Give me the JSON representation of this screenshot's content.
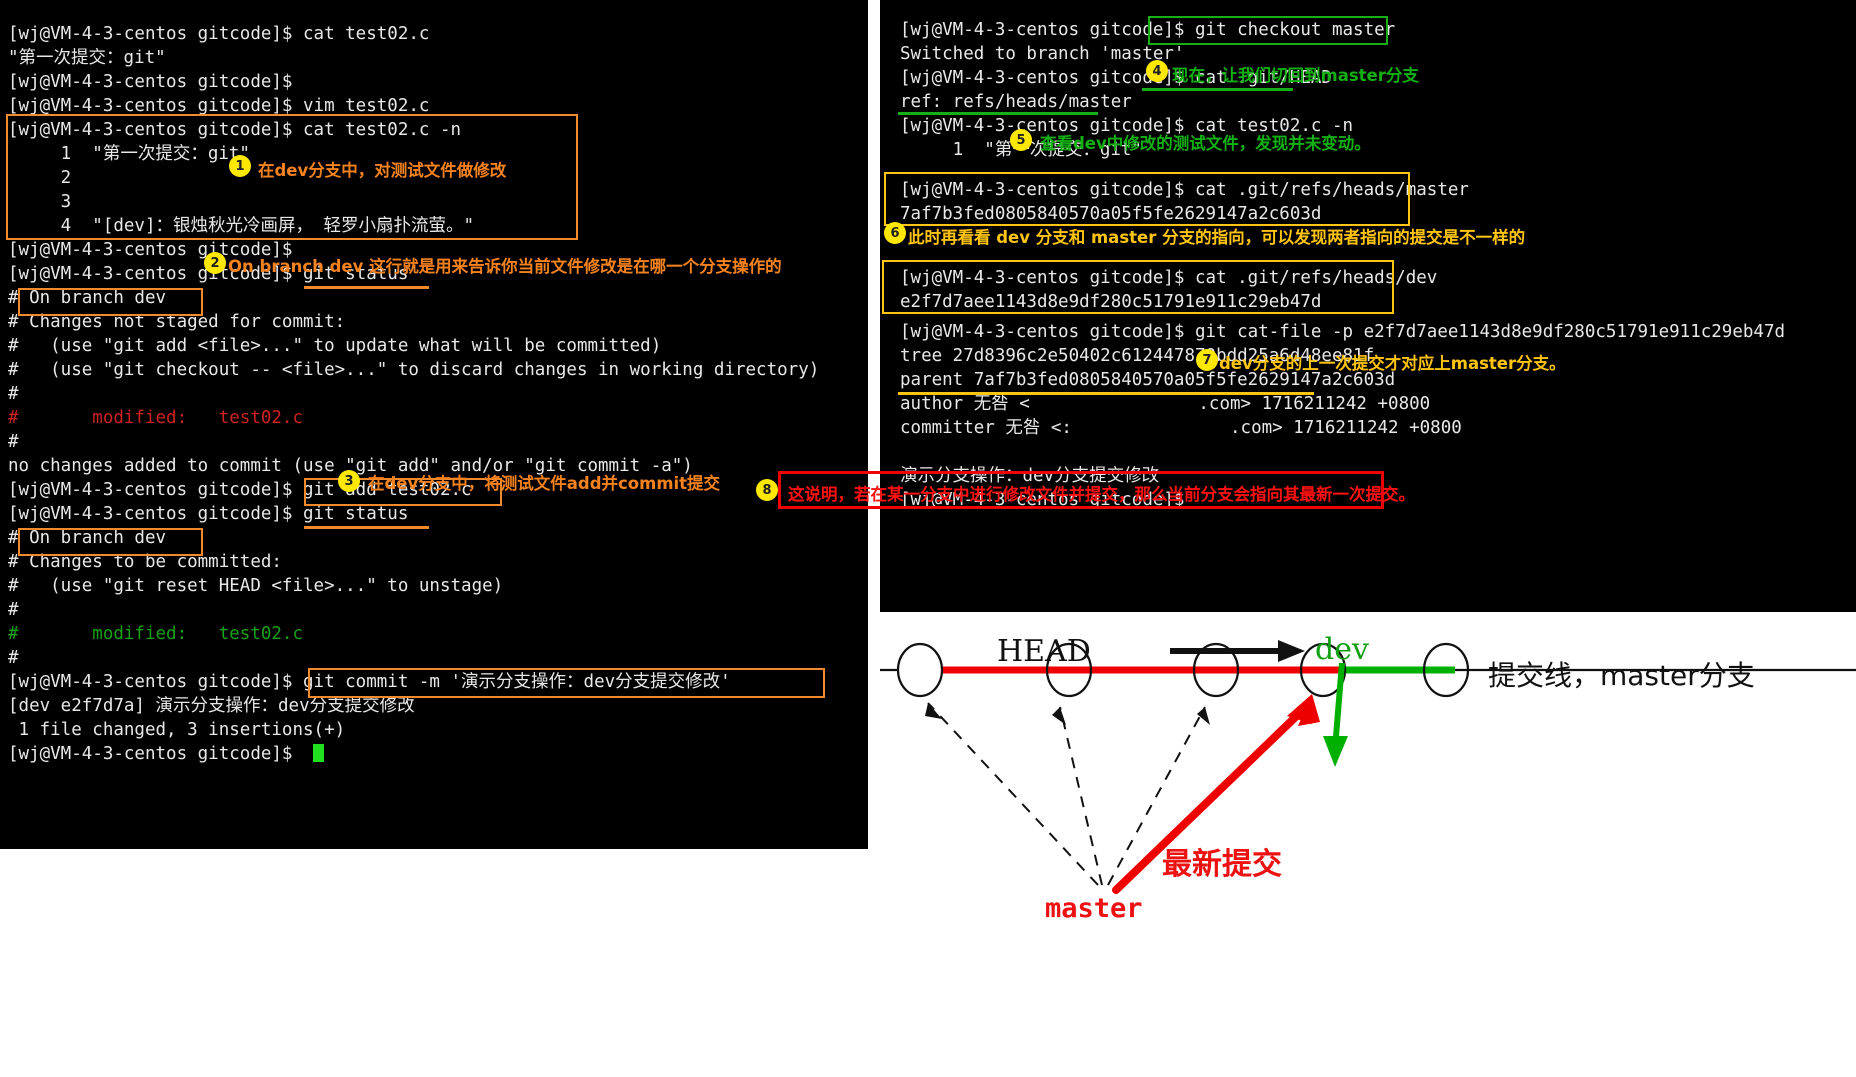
{
  "prompt": "[wj@VM-4-3-centos gitcode]$ ",
  "left_terminal": {
    "name": "left-terminal",
    "lines": [
      {
        "t": "[wj@VM-4-3-centos gitcode]$ cat test02.c"
      },
      {
        "t": "\"第一次提交：git\""
      },
      {
        "t": "[wj@VM-4-3-centos gitcode]$"
      },
      {
        "t": "[wj@VM-4-3-centos gitcode]$ vim test02.c"
      },
      {
        "t": "[wj@VM-4-3-centos gitcode]$ cat test02.c -n"
      },
      {
        "t": "     1  \"第一次提交：git\""
      },
      {
        "t": "     2"
      },
      {
        "t": "     3"
      },
      {
        "t": "     4  \"[dev]：银烛秋光冷画屏， 轻罗小扇扑流萤。\""
      },
      {
        "t": "[wj@VM-4-3-centos gitcode]$"
      },
      {
        "t": "[wj@VM-4-3-centos gitcode]$ git status"
      },
      {
        "t": "# On branch dev"
      },
      {
        "t": "# Changes not staged for commit:"
      },
      {
        "t": "#   (use \"git add <file>...\" to update what will be committed)"
      },
      {
        "t": "#   (use \"git checkout -- <file>...\" to discard changes in working directory)"
      },
      {
        "t": "#"
      },
      {
        "t": "#       modified:   test02.c",
        "c": "red"
      },
      {
        "t": "#"
      },
      {
        "t": "no changes added to commit (use \"git add\" and/or \"git commit -a\")"
      },
      {
        "t": "[wj@VM-4-3-centos gitcode]$ git add test02.c"
      },
      {
        "t": "[wj@VM-4-3-centos gitcode]$ git status"
      },
      {
        "t": "# On branch dev"
      },
      {
        "t": "# Changes to be committed:"
      },
      {
        "t": "#   (use \"git reset HEAD <file>...\" to unstage)"
      },
      {
        "t": "#"
      },
      {
        "t": "#       modified:   test02.c",
        "c": "green"
      },
      {
        "t": "#"
      },
      {
        "t": "[wj@VM-4-3-centos gitcode]$ git commit -m '演示分支操作：dev分支提交修改'"
      },
      {
        "t": "[dev e2f7d7a] 演示分支操作：dev分支提交修改"
      },
      {
        "t": " 1 file changed, 3 insertions(+)"
      },
      {
        "t": "[wj@VM-4-3-centos gitcode]$"
      }
    ]
  },
  "right_terminal": {
    "name": "right-terminal",
    "lines": [
      {
        "t": "[wj@VM-4-3-centos gitcode]$ git checkout master"
      },
      {
        "t": "Switched to branch 'master'"
      },
      {
        "t": "[wj@VM-4-3-centos gitcode]$ cat .git/HEAD"
      },
      {
        "t": "ref: refs/heads/master"
      },
      {
        "t": "[wj@VM-4-3-centos gitcode]$ cat test02.c -n"
      },
      {
        "t": "     1  \"第一次提交：git\""
      },
      {
        "t": ""
      },
      {
        "t": "[wj@VM-4-3-centos gitcode]$ cat .git/refs/heads/master"
      },
      {
        "t": "7af7b3fed0805840570a05f5fe2629147a2c603d"
      },
      {
        "t": ""
      },
      {
        "t": ""
      },
      {
        "t": "[wj@VM-4-3-centos gitcode]$ cat .git/refs/heads/dev"
      },
      {
        "t": "e2f7d7aee1143d8e9df280c51791e911c29eb47d"
      },
      {
        "t": "[wj@VM-4-3-centos gitcode]$ git cat-file -p e2f7d7aee1143d8e9df280c51791e911c29eb47d"
      },
      {
        "t": "tree 27d8396c2e50402c612447870bdd25a6d48ee81f"
      },
      {
        "t": "parent 7af7b3fed0805840570a05f5fe2629147a2c603d"
      },
      {
        "t": "author 无咎 <                .com> 1716211242 +0800"
      },
      {
        "t": "committer 无咎 <:               .com> 1716211242 +0800"
      },
      {
        "t": ""
      },
      {
        "t": "演示分支操作：dev分支提交修改"
      },
      {
        "t": "[wj@VM-4-3-centos gitcode]$"
      }
    ]
  },
  "annotations": [
    {
      "n": "1",
      "text": "在dev分支中，对测试文件做修改",
      "color": "orange"
    },
    {
      "n": "2",
      "text": "On branch dev 这行就是用来告诉你当前文件修改是在哪一个分支操作的",
      "color": "orange"
    },
    {
      "n": "3",
      "text": "在dev分支中，将测试文件add并commit提交",
      "color": "orange"
    },
    {
      "n": "4",
      "text": "现在，让我们切回到master分支",
      "color": "green"
    },
    {
      "n": "5",
      "text": "查看dev中修改的测试文件，发现并未变动。",
      "color": "green"
    },
    {
      "n": "6",
      "text": "此时再看看 dev 分支和 master 分支的指向，可以发现两者指向的提交是不一样的",
      "color": "yellow"
    },
    {
      "n": "7",
      "text": "dev分支的上一次提交才对应上master分支。",
      "color": "yellow"
    },
    {
      "n": "8",
      "text": "这说明，若在某一分支中进行修改文件并提交，那么当前分支会指向其最新一次提交。",
      "color": "red"
    }
  ],
  "diagram": {
    "name": "branch-diagram",
    "head_label": "HEAD",
    "dev_label": "dev",
    "commit_line_label": "提交线，master分支",
    "newest_commit_label": "最新提交",
    "master_label": "master",
    "commit_count": 5,
    "colors": {
      "red": "#ee0000",
      "green": "#00b000",
      "black": "#111111"
    }
  }
}
